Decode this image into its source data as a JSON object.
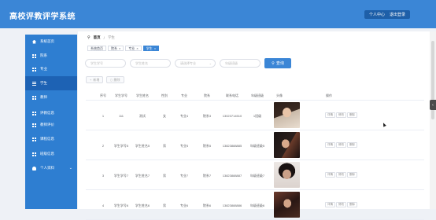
{
  "header": {
    "title": "高校评教评学系统",
    "user_center": "个人中心",
    "logout": "退出登录"
  },
  "sidebar": {
    "items": [
      {
        "label": "系统首页",
        "icon": "home-icon",
        "active": false
      },
      {
        "label": "院系",
        "icon": "grid-icon",
        "active": false
      },
      {
        "label": "专业",
        "icon": "grid-icon",
        "active": false
      },
      {
        "label": "学生",
        "icon": "menu-icon",
        "active": true
      },
      {
        "label": "教师",
        "icon": "grid-icon",
        "active": false
      },
      {
        "label": "评教信息",
        "icon": "grid-icon",
        "active": false
      },
      {
        "label": "教师评价",
        "icon": "grid-icon",
        "active": false
      },
      {
        "label": "课程信息",
        "icon": "grid-icon",
        "active": false
      },
      {
        "label": "班级信息",
        "icon": "grid-icon",
        "active": false
      },
      {
        "label": "个人资料",
        "icon": "person-icon",
        "active": false
      }
    ]
  },
  "breadcrumb": {
    "home": "首页",
    "separator": "/",
    "current": "学生"
  },
  "tabs": [
    {
      "label": "系统首页",
      "active": false
    },
    {
      "label": "院系",
      "active": false
    },
    {
      "label": "专业",
      "active": false
    },
    {
      "label": "学生",
      "active": true
    }
  ],
  "filters": {
    "f1": "学生学号",
    "f2": "学生姓名",
    "f3": "请选择专业",
    "f4": "年级班级",
    "query_label": "查询"
  },
  "actions": {
    "add": "新增",
    "delete": "删除"
  },
  "table": {
    "columns": [
      "序号",
      "学生学号",
      "学生姓名",
      "性别",
      "专业",
      "院系",
      "联系电话",
      "年级班级",
      "头像",
      "操作"
    ],
    "rows": [
      {
        "index": "1",
        "id": "111",
        "name": "测试",
        "gender": "女",
        "major": "专业4",
        "dept": "院系3",
        "phone": "13023714510",
        "klass": "1班级",
        "photo": "photo-1"
      },
      {
        "index": "2",
        "id": "学生学号5",
        "name": "学生姓名5",
        "gender": "男",
        "major": "专业5",
        "dept": "院系5",
        "phone": "13823888885",
        "klass": "年级班级5",
        "photo": "photo-2"
      },
      {
        "index": "3",
        "id": "学生学号7",
        "name": "学生姓名7",
        "gender": "男",
        "major": "专业7",
        "dept": "院系7",
        "phone": "13823888887",
        "klass": "年级班级7",
        "photo": "photo-3"
      },
      {
        "index": "4",
        "id": "学生学号6",
        "name": "学生姓名6",
        "gender": "男",
        "major": "专业6",
        "dept": "院系6",
        "phone": "13823888886",
        "klass": "年级班级6",
        "photo": "photo-4"
      }
    ],
    "ops": [
      "详情",
      "修改",
      "删除"
    ]
  },
  "colors": {
    "header": "#3b86d6",
    "sidebar": "#2e7ed1",
    "sidebar_active": "#1d62b4",
    "accent": "#3b86d6"
  }
}
